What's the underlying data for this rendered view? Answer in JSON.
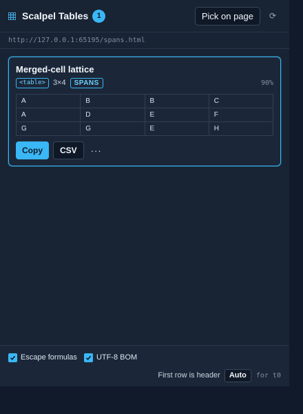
{
  "header": {
    "title": "Scalpel Tables",
    "count": "1",
    "pick_label": "Pick on page",
    "refresh_glyph": "⟳",
    "icon": "grid-table-icon"
  },
  "url": "http://127.0.0.1:65195/spans.html",
  "card": {
    "title": "Merged-cell lattice",
    "tag": "<table>",
    "dims": "3×4",
    "spans_badge": "SPANS",
    "confidence": "90%",
    "rows": [
      [
        "A",
        "B",
        "B",
        "C"
      ],
      [
        "A",
        "D",
        "E",
        "F"
      ],
      [
        "G",
        "G",
        "E",
        "H"
      ]
    ],
    "copy_label": "Copy",
    "csv_label": "CSV",
    "more_label": "···"
  },
  "footer": {
    "escape_formulas": "Escape formulas",
    "utf8_bom": "UTF-8 BOM",
    "first_row_label": "First row is header",
    "auto_label": "Auto",
    "for_label": "for t0"
  },
  "colors": {
    "accent": "#3ab7f5",
    "background": "#111a2a",
    "panel": "#182333"
  }
}
